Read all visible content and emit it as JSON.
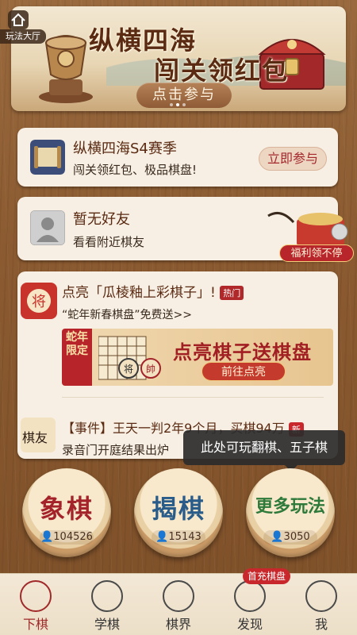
{
  "banner": {
    "title_line1": "纵横四海",
    "title_line2": "闯关领红包",
    "join_label": "点击参与"
  },
  "home": {
    "label": "玩法大厅",
    "icon": "home-icon"
  },
  "season_card": {
    "title": "纵横四海S4赛季",
    "subtitle": "闯关领红包、极品棋盘!",
    "button": "立即参与"
  },
  "friends_card": {
    "title": "暂无好友",
    "subtitle": "看看附近棋友"
  },
  "welfare": {
    "label": "福利领不停"
  },
  "feed": {
    "item1": {
      "title": "点亮「瓜棱釉上彩棋子」!",
      "hot": "热门",
      "subtitle": "“蛇年新春棋盘”免费送>>",
      "promo_tag": "蛇年限定",
      "promo_title": "点亮棋子送棋盘",
      "promo_button": "前往点亮"
    },
    "item2": {
      "avatar_text": "棋友",
      "title": "【事件】王天一判2年9个月，买棋94万",
      "new": "新",
      "subtitle": "录音门开庭结果出炉"
    }
  },
  "tooltip": "此处可玩翻棋、五子棋",
  "games": [
    {
      "name": "象棋",
      "count": "104526",
      "color": "#a4232a"
    },
    {
      "name": "揭棋",
      "count": "15143",
      "color": "#2a5c8a"
    },
    {
      "name": "更多玩法",
      "count": "3050",
      "color": "#2e7a3a"
    }
  ],
  "first_charge_badge": "首充棋盘",
  "tabs": [
    {
      "label": "下棋",
      "icon": "shuai-icon",
      "active": true
    },
    {
      "label": "学棋",
      "icon": "book-icon",
      "active": false
    },
    {
      "label": "棋界",
      "icon": "chat-icon",
      "active": false
    },
    {
      "label": "发现",
      "icon": "compass-icon",
      "active": false
    },
    {
      "label": "我",
      "icon": "user-icon",
      "active": false
    }
  ]
}
